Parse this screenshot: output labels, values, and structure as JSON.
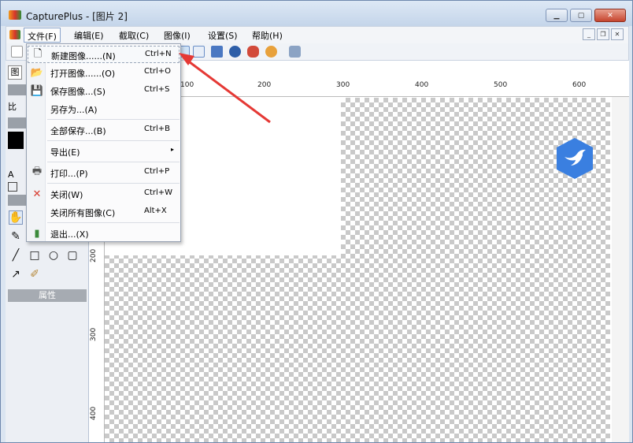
{
  "window": {
    "app_name": "CapturePlus",
    "title": "CapturePlus - [图片 2]",
    "min": "▁",
    "max": "▢",
    "close": "✕"
  },
  "menubar": {
    "file": "文件(F)",
    "edit": "编辑(E)",
    "capture": "截取(C)",
    "image": "图像(I)",
    "settings": "设置(S)",
    "help": "帮助(H)"
  },
  "mdi": {
    "min": "_",
    "restore": "❐",
    "close": "✕"
  },
  "left_panel": {
    "label_tu": "图",
    "label_bi": "比",
    "label_a": "A",
    "attr": "属性"
  },
  "ruler": {
    "top": [
      "100",
      "200",
      "300",
      "400",
      "500",
      "600"
    ],
    "left": [
      "200",
      "300",
      "400"
    ]
  },
  "file_menu": [
    {
      "label": "新建图像......(N)",
      "shortcut": "Ctrl+N",
      "icon": "new-image-icon"
    },
    {
      "label": "打开图像......(O)",
      "shortcut": "Ctrl+O",
      "icon": "open-image-icon"
    },
    {
      "label": "保存图像...(S)",
      "shortcut": "Ctrl+S",
      "icon": "save-image-icon"
    },
    {
      "label": "另存为...(A)",
      "shortcut": "",
      "icon": ""
    },
    {
      "label": "全部保存...(B)",
      "shortcut": "Ctrl+B",
      "icon": ""
    },
    {
      "label": "导出(E)",
      "shortcut": "",
      "icon": "",
      "submenu": "▸"
    },
    {
      "label": "打印...(P)",
      "shortcut": "Ctrl+P",
      "icon": "printer-icon"
    },
    {
      "label": "关闭(W)",
      "shortcut": "Ctrl+W",
      "icon": "close-red-icon"
    },
    {
      "label": "关闭所有图像(C)",
      "shortcut": "Alt+X",
      "icon": ""
    },
    {
      "label": "退出...(X)",
      "shortcut": "",
      "icon": "exit-icon"
    }
  ],
  "colors": {
    "badge": "#3a7fe0",
    "arrow": "#e53935",
    "accent": "#8aa4cb"
  }
}
